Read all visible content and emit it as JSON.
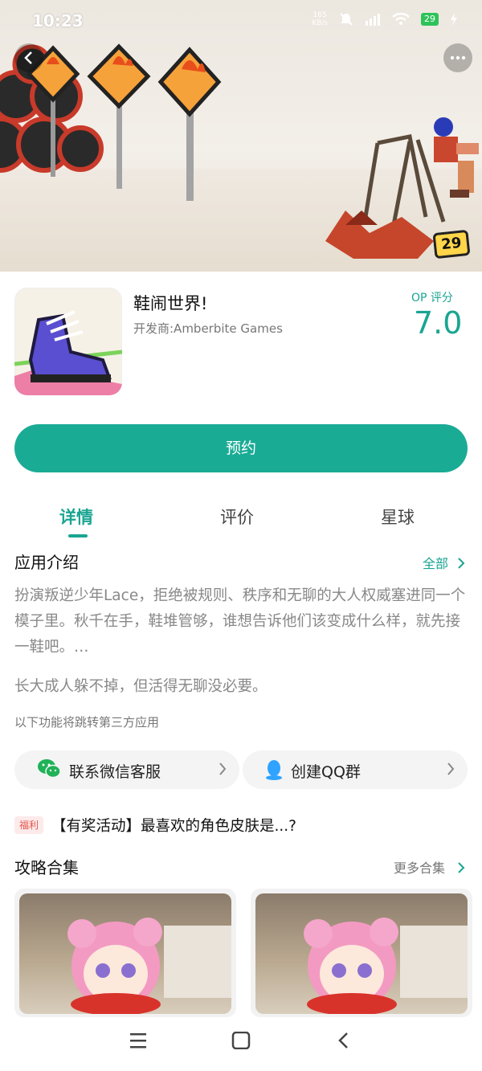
{
  "status": {
    "time": "10:23",
    "speed_value": "165",
    "speed_unit": "KB/s",
    "battery": "29"
  },
  "hero": {
    "score_badge": "29"
  },
  "app": {
    "name": "鞋闹世界!",
    "developer": "开发商:Amberbite Games",
    "rating_label": "OP 评分",
    "rating_value": "7.0"
  },
  "actions": {
    "reserve_label": "预约"
  },
  "tabs": [
    {
      "label": "详情",
      "active": true
    },
    {
      "label": "评价",
      "active": false
    },
    {
      "label": "星球",
      "active": false
    }
  ],
  "intro": {
    "title": "应用介绍",
    "see_all": "全部",
    "description": "扮演叛逆少年Lace，拒绝被规则、秩序和无聊的大人权威塞进同一个模子里。秋千在手，鞋堆管够，谁想告诉他们该变成什么样，就先接一鞋吧。…",
    "tagline": "长大成人躲不掉，但活得无聊没必要。",
    "third_party_note": "以下功能将跳转第三方应用"
  },
  "links": {
    "wechat": "联系微信客服",
    "qq": "创建QQ群"
  },
  "promo": {
    "tag": "福利",
    "text": "【有奖活动】最喜欢的角色皮肤是...?"
  },
  "guides": {
    "title": "攻略合集",
    "more": "更多合集"
  },
  "colors": {
    "accent": "#1aab95",
    "promo_red": "#e2574c"
  }
}
